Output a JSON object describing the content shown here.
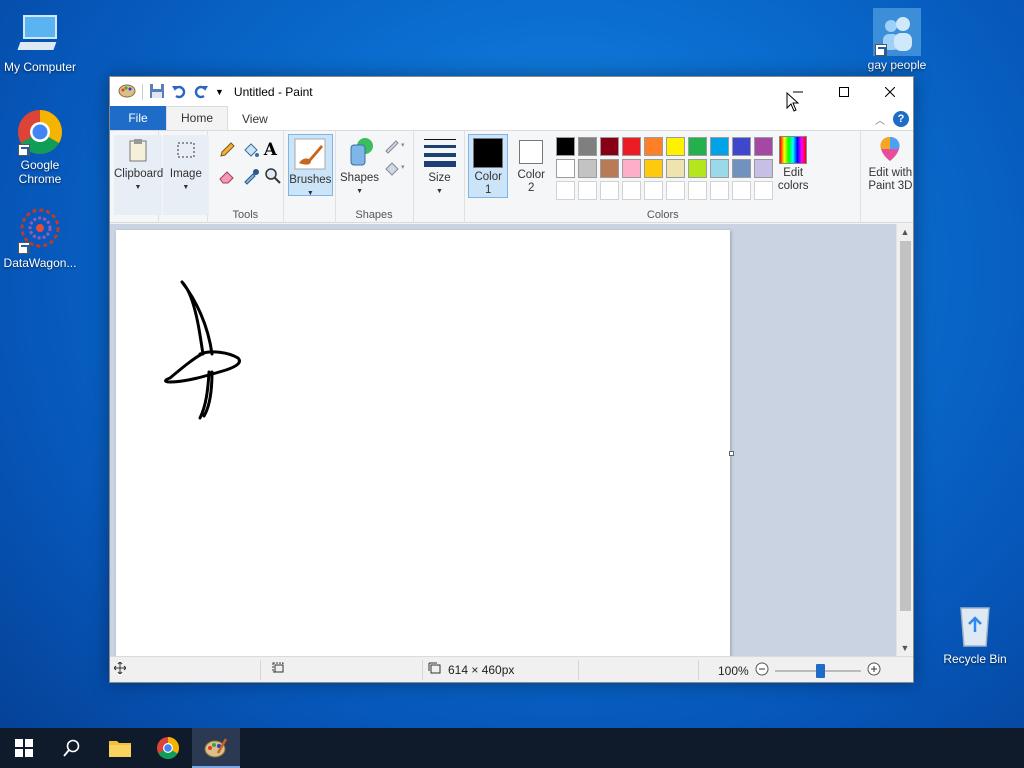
{
  "desktop": {
    "icons": [
      {
        "label": "My Computer"
      },
      {
        "label": "Google Chrome"
      },
      {
        "label": "DataWagon..."
      },
      {
        "label": "gay people"
      },
      {
        "label": "Recycle Bin"
      }
    ]
  },
  "window": {
    "title": "Untitled - Paint",
    "tabs": {
      "file": "File",
      "home": "Home",
      "view": "View"
    },
    "help": "?"
  },
  "ribbon": {
    "clipboard": "Clipboard",
    "image": "Image",
    "tools": "Tools",
    "brushes": "Brushes",
    "shapes_btn": "Shapes",
    "shapes_group": "Shapes",
    "size": "Size",
    "color1_line1": "Color",
    "color1_line2": "1",
    "color2_line1": "Color",
    "color2_line2": "2",
    "colors_group": "Colors",
    "edit_colors_line1": "Edit",
    "edit_colors_line2": "colors",
    "paint3d_line1": "Edit with",
    "paint3d_line2": "Paint 3D",
    "text_tool_glyph": "A",
    "palette_row1": [
      "#000000",
      "#7f7f7f",
      "#880015",
      "#ed1c24",
      "#ff7f27",
      "#fff200",
      "#22b14c",
      "#00a2e8",
      "#3f48cc",
      "#a349a4"
    ],
    "palette_row2": [
      "#ffffff",
      "#c3c3c3",
      "#b97a57",
      "#ffaec9",
      "#ffc90e",
      "#efe4b0",
      "#b5e61d",
      "#99d9ea",
      "#7092be",
      "#c8bfe7"
    ],
    "color1": "#000000",
    "color2": "#ffffff"
  },
  "status": {
    "dimensions": "614 × 460px",
    "zoom": "100%",
    "zoom_fraction": 0.5
  }
}
